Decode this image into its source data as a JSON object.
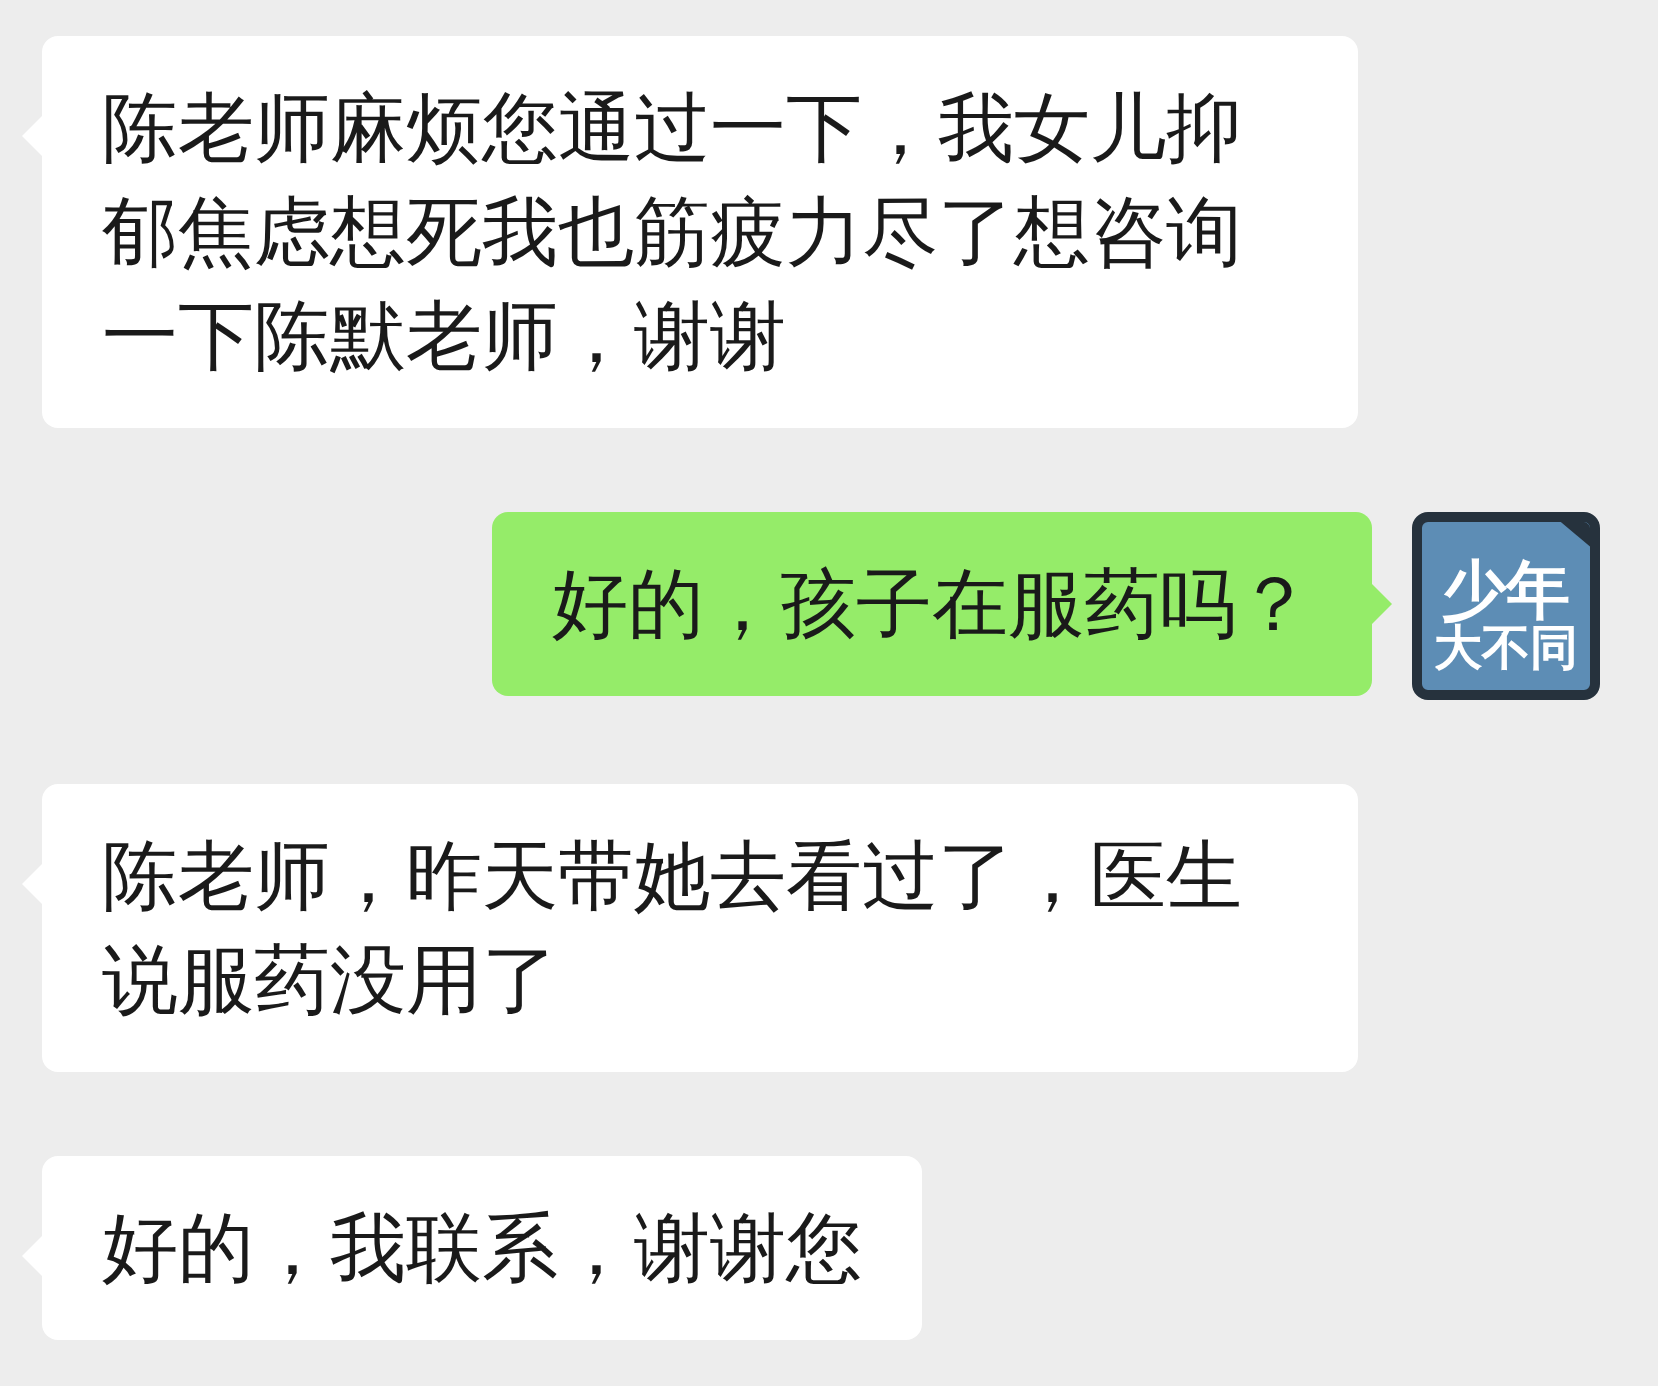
{
  "messages": [
    {
      "kind": "received",
      "text": "陈老师麻烦您通过一下，我女儿抑郁焦虑想死我也筋疲力尽了想咨询一下陈默老师，谢谢"
    },
    {
      "kind": "sent",
      "text": "好的，孩子在服药吗？",
      "avatar": {
        "lines": [
          "少年",
          "大不同"
        ]
      }
    },
    {
      "kind": "received",
      "text": "陈老师，昨天带她去看过了，医生说服药没用了"
    },
    {
      "kind": "received",
      "text": "好的，我联系，谢谢您"
    }
  ]
}
